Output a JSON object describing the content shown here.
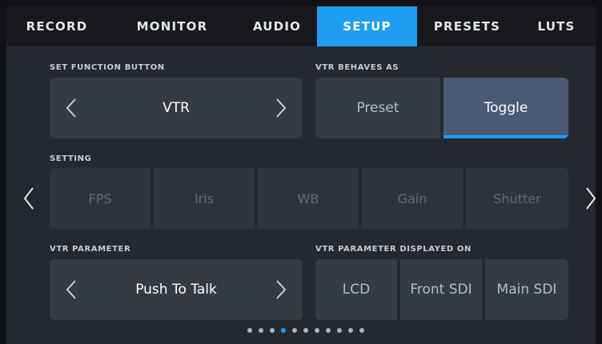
{
  "tabs": [
    {
      "label": "RECORD",
      "active": false
    },
    {
      "label": "MONITOR",
      "active": false
    },
    {
      "label": "AUDIO",
      "active": false
    },
    {
      "label": "SETUP",
      "active": true
    },
    {
      "label": "PRESETS",
      "active": false
    },
    {
      "label": "LUTS",
      "active": false
    }
  ],
  "set_function_button": {
    "label": "SET FUNCTION BUTTON",
    "value": "VTR"
  },
  "vtr_behaves_as": {
    "label": "VTR BEHAVES AS",
    "options": [
      "Preset",
      "Toggle"
    ],
    "selected": "Toggle"
  },
  "setting": {
    "label": "SETTING",
    "options": [
      "FPS",
      "Iris",
      "WB",
      "Gain",
      "Shutter"
    ]
  },
  "vtr_parameter": {
    "label": "VTR PARAMETER",
    "value": "Push To Talk"
  },
  "vtr_parameter_displayed_on": {
    "label": "VTR PARAMETER DISPLAYED ON",
    "options": [
      "LCD",
      "Front SDI",
      "Main SDI"
    ]
  },
  "pagination": {
    "total": 11,
    "current": 4
  },
  "colors": {
    "accent": "#1e9df2",
    "panel": "#353b44",
    "background": "#25292f",
    "tab_bar": "#17191d"
  }
}
